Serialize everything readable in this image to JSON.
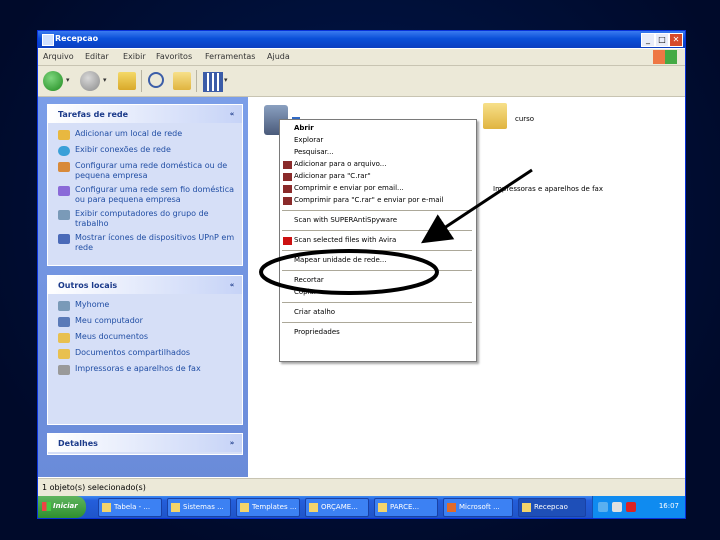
{
  "window": {
    "title": "Recepcao"
  },
  "menubar": [
    "Arquivo",
    "Editar",
    "Exibir",
    "Favoritos",
    "Ferramentas",
    "Ajuda"
  ],
  "left_panel": {
    "network_tasks": {
      "title": "Tarefas de rede",
      "collapse": "«",
      "items": [
        "Adicionar um local de rede",
        "Exibir conexões de rede",
        "Configurar uma rede doméstica ou de pequena empresa",
        "Configurar uma rede sem fio doméstica ou para pequena empresa",
        "Exibir computadores do grupo de trabalho",
        "Mostrar ícones de dispositivos UPnP em rede"
      ]
    },
    "other_places": {
      "title": "Outros locais",
      "collapse": "«",
      "items": [
        "Myhome",
        "Meu computador",
        "Meus documentos",
        "Documentos compartilhados",
        "Impressoras e aparelhos de fax"
      ]
    },
    "details": {
      "title": "Detalhes",
      "collapse": "»"
    }
  },
  "files": [
    {
      "name": "s",
      "icon": "network-folder-icon"
    },
    {
      "name": "curso",
      "icon": "shared-folder-icon"
    },
    {
      "name": "Impressoras e aparelhos de fax",
      "icon": "printer-icon"
    }
  ],
  "context_menu": {
    "groups": [
      [
        "Abrir",
        "Explorar",
        "Pesquisar...",
        "Adicionar para o arquivo...",
        "Adicionar para \"C.rar\"",
        "Comprimir e enviar por email...",
        "Comprimir para \"C.rar\" e enviar por e-mail"
      ],
      [
        "Scan with SUPERAntiSpyware"
      ],
      [
        "Scan selected files with Avira"
      ],
      [
        "Mapear unidade de rede..."
      ],
      [
        "Recortar",
        "Copiar"
      ],
      [
        "Criar atalho"
      ],
      [
        "Propriedades"
      ]
    ]
  },
  "status": {
    "text": "1 objeto(s) selecionado(s)"
  },
  "taskbar": {
    "start": "Iniciar",
    "buttons": [
      "Tabela - ...",
      "Sistemas ...",
      "Templates ...",
      "ORÇAME...",
      "PARCE...",
      "Microsoft ...",
      "Recepcao"
    ],
    "clock": "16:07"
  }
}
